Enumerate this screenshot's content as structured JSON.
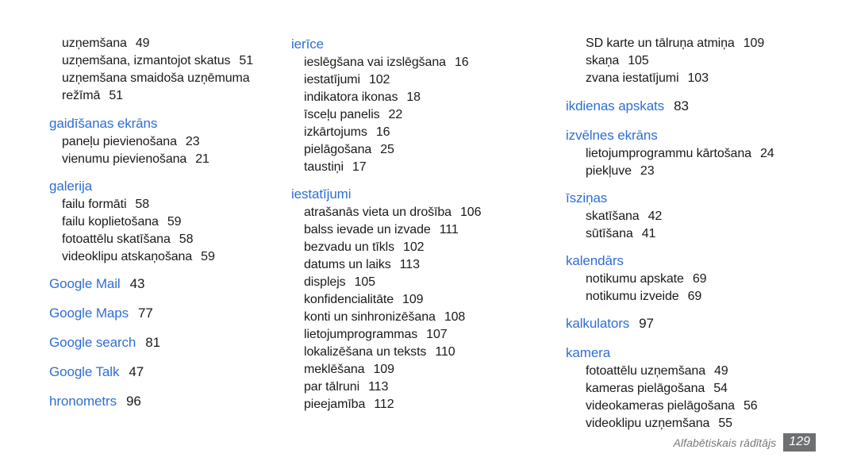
{
  "document": {
    "type": "index-page",
    "language": "lv",
    "heading_color": "#2f6ed5",
    "text_color": "#1a1a1a",
    "footer_label_color": "#76787a",
    "footer_badge_color": "#6d6f71"
  },
  "columns": [
    {
      "id": "column-left",
      "groups": [
        {
          "id": "group-continued-uznemsana",
          "heading": null,
          "heading_page": null,
          "entries": [
            {
              "label": "uzņemšana",
              "page": "49"
            },
            {
              "label": "uzņemšana, izmantojot skatus",
              "page": "51"
            },
            {
              "label": "uzņemšana smaidoša uzņēmuma",
              "page": ""
            },
            {
              "label": "režīmā",
              "page": "51"
            }
          ]
        },
        {
          "id": "group-gaidisanas-ekrans",
          "heading": "gaidīšanas ekrāns",
          "heading_page": null,
          "entries": [
            {
              "label": "paneļu pievienošana",
              "page": "23"
            },
            {
              "label": "vienumu pievienošana",
              "page": "21"
            }
          ]
        },
        {
          "id": "group-galerija",
          "heading": "galerija",
          "heading_page": null,
          "entries": [
            {
              "label": "failu formāti",
              "page": "58"
            },
            {
              "label": "failu koplietošana",
              "page": "59"
            },
            {
              "label": "fotoattēlu skatīšana",
              "page": "58"
            },
            {
              "label": "videoklipu atskaņošana",
              "page": "59"
            }
          ]
        },
        {
          "id": "group-google-mail",
          "heading": "Google Mail",
          "heading_page": "43",
          "entries": []
        },
        {
          "id": "group-google-maps",
          "heading": "Google Maps",
          "heading_page": "77",
          "entries": []
        },
        {
          "id": "group-google-search",
          "heading": "Google search",
          "heading_page": "81",
          "entries": []
        },
        {
          "id": "group-google-talk",
          "heading": "Google Talk",
          "heading_page": "47",
          "entries": []
        },
        {
          "id": "group-hronometrs",
          "heading": "hronometrs",
          "heading_page": "96",
          "entries": []
        }
      ]
    },
    {
      "id": "column-middle",
      "groups": [
        {
          "id": "group-ierice",
          "heading": "ierīce",
          "heading_page": null,
          "entries": [
            {
              "label": "ieslēgšana vai izslēgšana",
              "page": "16"
            },
            {
              "label": "iestatījumi",
              "page": "102"
            },
            {
              "label": "indikatora ikonas",
              "page": "18"
            },
            {
              "label": "īsceļu panelis",
              "page": "22"
            },
            {
              "label": "izkārtojums",
              "page": "16"
            },
            {
              "label": "pielāgošana",
              "page": "25"
            },
            {
              "label": "taustiņi",
              "page": "17"
            }
          ]
        },
        {
          "id": "group-iestatijumi",
          "heading": "iestatījumi",
          "heading_page": null,
          "entries": [
            {
              "label": "atrašanās vieta un drošība",
              "page": "106"
            },
            {
              "label": "balss ievade un izvade",
              "page": "111"
            },
            {
              "label": "bezvadu un tīkls",
              "page": "102"
            },
            {
              "label": "datums un laiks",
              "page": "113"
            },
            {
              "label": "displejs",
              "page": "105"
            },
            {
              "label": "konfidencialitāte",
              "page": "109"
            },
            {
              "label": "konti un sinhronizēšana",
              "page": "108"
            },
            {
              "label": "lietojumprogrammas",
              "page": "107"
            },
            {
              "label": "lokalizēšana un teksts",
              "page": "110"
            },
            {
              "label": "meklēšana",
              "page": "109"
            },
            {
              "label": "par tālruni",
              "page": "113"
            },
            {
              "label": "pieejamība",
              "page": "112"
            }
          ]
        }
      ]
    },
    {
      "id": "column-right",
      "groups": [
        {
          "id": "group-continued-iestatijumi",
          "heading": null,
          "heading_page": null,
          "entries": [
            {
              "label": "SD karte un tālruņa atmiņa",
              "page": "109"
            },
            {
              "label": "skaņa",
              "page": "105"
            },
            {
              "label": "zvana iestatījumi",
              "page": "103"
            }
          ]
        },
        {
          "id": "group-ikdienas-apskats",
          "heading": "ikdienas apskats",
          "heading_page": "83",
          "entries": []
        },
        {
          "id": "group-izvelnes-ekrans",
          "heading": "izvēlnes ekrāns",
          "heading_page": null,
          "entries": [
            {
              "label": "lietojumprogrammu kārtošana",
              "page": "24"
            },
            {
              "label": "piekļuve",
              "page": "23"
            }
          ]
        },
        {
          "id": "group-iszinas",
          "heading": "īsziņas",
          "heading_page": null,
          "entries": [
            {
              "label": "skatīšana",
              "page": "42"
            },
            {
              "label": "sūtīšana",
              "page": "41"
            }
          ]
        },
        {
          "id": "group-kalendars",
          "heading": "kalendārs",
          "heading_page": null,
          "entries": [
            {
              "label": "notikumu apskate",
              "page": "69"
            },
            {
              "label": "notikumu izveide",
              "page": "69"
            }
          ]
        },
        {
          "id": "group-kalkulators",
          "heading": "kalkulators",
          "heading_page": "97",
          "entries": []
        },
        {
          "id": "group-kamera",
          "heading": "kamera",
          "heading_page": null,
          "entries": [
            {
              "label": "fotoattēlu uzņemšana",
              "page": "49"
            },
            {
              "label": "kameras pielāgošana",
              "page": "54"
            },
            {
              "label": "videokameras pielāgošana",
              "page": "56"
            },
            {
              "label": "videoklipu uzņemšana",
              "page": "55"
            }
          ]
        }
      ]
    }
  ],
  "footer": {
    "label": "Alfabētiskais rādītājs",
    "page_number": "129"
  }
}
